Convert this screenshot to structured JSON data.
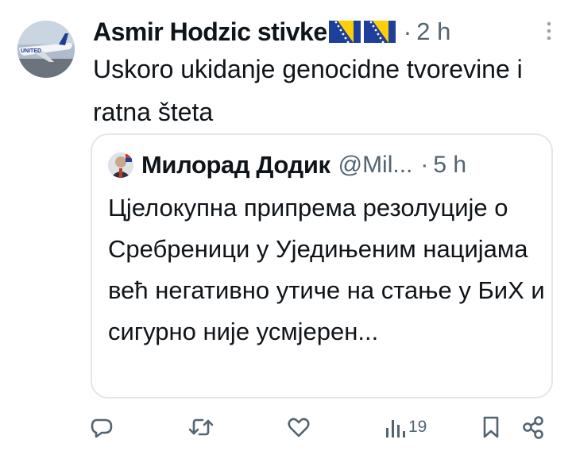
{
  "post": {
    "author_name": "Asmir Hodzic stivke",
    "separator": "·",
    "time": "2 h",
    "flag_icon": "bosnia-herzegovina-flag-icon",
    "text": "Uskoro ukidanje genocidne tvorevine i ratna šteta",
    "avatar_label": "UNITED"
  },
  "quote": {
    "author_name": "Милорад Додик",
    "handle": "@Mil...",
    "separator": "·",
    "time": "5 h",
    "text": "Цјелокупна припрема резолуције о Сребреници у Уједињеним нацијама већ негативно утиче на стање у БиХ и сигурно није усмјерен..."
  },
  "actions": {
    "views": "19",
    "icons": [
      "reply-icon",
      "retweet-icon",
      "like-icon",
      "views-icon",
      "bookmark-icon",
      "share-icon"
    ]
  },
  "colors": {
    "text": "#0f1419",
    "secondary": "#536471",
    "border": "#e3e7ea",
    "flag_blue": "#1e3f9a",
    "flag_yellow": "#fdcf09"
  }
}
